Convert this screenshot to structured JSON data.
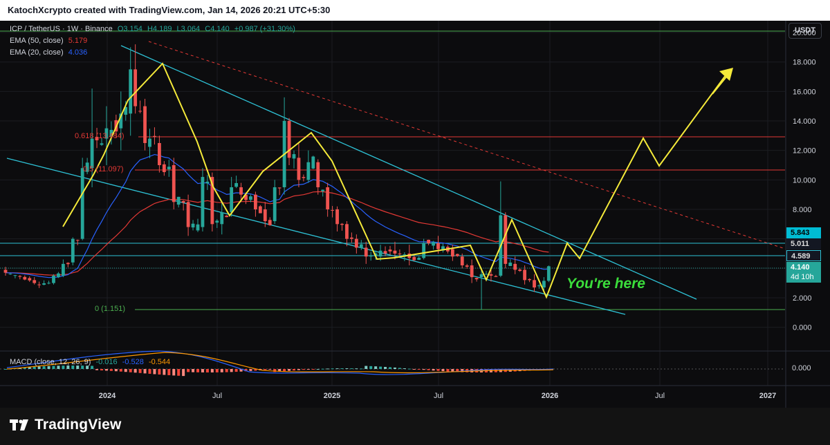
{
  "header": {
    "text": "KatochXcrypto created with TradingView.com, Jan 14, 2026 20:21 UTC+5:30"
  },
  "legend": {
    "symbol": "ICP / TetherUS · 1W · Binance",
    "open": "O3.154",
    "high": "H4.189",
    "low": "L3.064",
    "close": "C4.140",
    "change": "+0.987 (+31.30%)",
    "ema50_label": "EMA (50, close)",
    "ema50_value": "5.179",
    "ema20_label": "EMA (20, close)",
    "ema20_value": "4.036",
    "macd_label": "MACD (close, 12, 26, 9)",
    "macd_v1": "-0.016",
    "macd_v2": "-0.528",
    "macd_v3": "-0.544"
  },
  "currency": "USDT",
  "price_labels": {
    "l1": "5.843",
    "l2": "5.011",
    "l3": "4.589",
    "current": "4.140",
    "countdown": "4d 10h"
  },
  "fib": {
    "f618": "0.618 (13.484)",
    "f5": "0.5 (11.097)",
    "f0": "0 (1.151)"
  },
  "annotation": "You're here",
  "footer_logo": "TradingView",
  "colors": {
    "bull": "#26a69a",
    "bear": "#ef5350",
    "ema50": "#e53935",
    "ema20": "#2962ff",
    "trend": "#2ec2d6",
    "fib": "#e53935",
    "fib0": "#4caf50",
    "path": "#f5ea3a",
    "annotation": "#3bdd3b"
  },
  "chart_data": {
    "type": "candlestick",
    "yaxis": {
      "ticks": [
        "0.000",
        "2.000",
        "4.000",
        "6.000",
        "8.000",
        "10.000",
        "12.000",
        "14.000",
        "16.000",
        "18.000",
        "20.000"
      ],
      "range": [
        -0.3,
        20.8
      ]
    },
    "xaxis": {
      "ticks": [
        "2024",
        "Jul",
        "2025",
        "Jul",
        "2026",
        "Jul",
        "2027"
      ]
    },
    "series": [
      {
        "name": "EMA (50, close)",
        "value": 5.179
      },
      {
        "name": "EMA (20, close)",
        "value": 4.036
      }
    ],
    "key_points": [
      {
        "t": 0,
        "o": 3.9,
        "h": 4.1,
        "l": 3.5,
        "c": 3.7
      },
      {
        "t": 6,
        "o": 3.2,
        "h": 3.4,
        "l": 2.9,
        "c": 3.0
      },
      {
        "t": 10,
        "o": 3.0,
        "h": 3.6,
        "l": 2.9,
        "c": 3.5
      },
      {
        "t": 12,
        "o": 3.5,
        "h": 4.6,
        "l": 3.4,
        "c": 4.3
      },
      {
        "t": 14,
        "o": 4.4,
        "h": 6.1,
        "l": 4.2,
        "c": 6.0
      },
      {
        "t": 16,
        "o": 6.0,
        "h": 11.5,
        "l": 5.9,
        "c": 10.8
      },
      {
        "t": 18,
        "o": 10.8,
        "h": 16.2,
        "l": 9.5,
        "c": 12.8
      },
      {
        "t": 21,
        "o": 12.8,
        "h": 15.0,
        "l": 11.0,
        "c": 13.5
      },
      {
        "t": 24,
        "o": 13.5,
        "h": 16.0,
        "l": 12.0,
        "c": 14.5
      },
      {
        "t": 26,
        "o": 14.5,
        "h": 19.0,
        "l": 13.0,
        "c": 17.5
      },
      {
        "t": 27,
        "o": 17.5,
        "h": 19.2,
        "l": 14.5,
        "c": 15.0
      },
      {
        "t": 29,
        "o": 15.0,
        "h": 15.5,
        "l": 12.0,
        "c": 12.5
      },
      {
        "t": 32,
        "o": 12.5,
        "h": 13.0,
        "l": 10.5,
        "c": 11.0
      },
      {
        "t": 35,
        "o": 11.0,
        "h": 11.5,
        "l": 8.0,
        "c": 8.5
      },
      {
        "t": 38,
        "o": 8.5,
        "h": 9.0,
        "l": 6.2,
        "c": 6.8
      },
      {
        "t": 41,
        "o": 6.8,
        "h": 10.8,
        "l": 6.5,
        "c": 10.2
      },
      {
        "t": 43,
        "o": 10.2,
        "h": 10.5,
        "l": 6.5,
        "c": 7.0
      },
      {
        "t": 45,
        "o": 7.0,
        "h": 8.5,
        "l": 6.3,
        "c": 7.8
      },
      {
        "t": 47,
        "o": 7.8,
        "h": 10.2,
        "l": 7.5,
        "c": 9.5
      },
      {
        "t": 49,
        "o": 9.5,
        "h": 9.8,
        "l": 8.5,
        "c": 9.0
      },
      {
        "t": 52,
        "o": 9.0,
        "h": 9.2,
        "l": 7.5,
        "c": 8.0
      },
      {
        "t": 54,
        "o": 8.0,
        "h": 8.5,
        "l": 6.8,
        "c": 7.2
      },
      {
        "t": 56,
        "o": 7.2,
        "h": 10.0,
        "l": 7.0,
        "c": 9.5
      },
      {
        "t": 58,
        "o": 9.5,
        "h": 15.6,
        "l": 9.0,
        "c": 14.0
      },
      {
        "t": 59,
        "o": 14.0,
        "h": 14.2,
        "l": 11.0,
        "c": 11.5
      },
      {
        "t": 61,
        "o": 11.5,
        "h": 12.5,
        "l": 9.5,
        "c": 10.0
      },
      {
        "t": 63,
        "o": 10.0,
        "h": 12.0,
        "l": 9.8,
        "c": 11.2
      },
      {
        "t": 65,
        "o": 11.2,
        "h": 11.4,
        "l": 9.0,
        "c": 9.5
      },
      {
        "t": 67,
        "o": 9.5,
        "h": 9.8,
        "l": 7.5,
        "c": 8.0
      },
      {
        "t": 69,
        "o": 8.0,
        "h": 8.2,
        "l": 6.5,
        "c": 7.0
      },
      {
        "t": 71,
        "o": 7.0,
        "h": 7.2,
        "l": 5.5,
        "c": 6.0
      },
      {
        "t": 73,
        "o": 6.0,
        "h": 6.3,
        "l": 5.0,
        "c": 5.4
      },
      {
        "t": 75,
        "o": 5.4,
        "h": 5.8,
        "l": 4.3,
        "c": 4.8
      },
      {
        "t": 78,
        "o": 4.8,
        "h": 5.6,
        "l": 4.5,
        "c": 5.2
      },
      {
        "t": 81,
        "o": 5.2,
        "h": 5.8,
        "l": 4.6,
        "c": 5.0
      },
      {
        "t": 84,
        "o": 5.0,
        "h": 5.6,
        "l": 4.2,
        "c": 4.7
      },
      {
        "t": 87,
        "o": 4.7,
        "h": 6.0,
        "l": 4.6,
        "c": 5.7
      },
      {
        "t": 90,
        "o": 5.7,
        "h": 6.2,
        "l": 5.0,
        "c": 5.3
      },
      {
        "t": 93,
        "o": 5.3,
        "h": 5.6,
        "l": 4.5,
        "c": 4.8
      },
      {
        "t": 95,
        "o": 4.8,
        "h": 5.0,
        "l": 4.0,
        "c": 4.2
      },
      {
        "t": 97,
        "o": 4.2,
        "h": 4.6,
        "l": 3.0,
        "c": 3.4
      },
      {
        "t": 99,
        "o": 3.4,
        "h": 4.0,
        "l": 1.2,
        "c": 3.6
      },
      {
        "t": 101,
        "o": 3.6,
        "h": 4.0,
        "l": 3.1,
        "c": 3.5
      },
      {
        "t": 103,
        "o": 3.5,
        "h": 9.9,
        "l": 3.4,
        "c": 7.6
      },
      {
        "t": 104,
        "o": 7.6,
        "h": 7.8,
        "l": 4.0,
        "c": 4.3
      },
      {
        "t": 106,
        "o": 4.3,
        "h": 4.8,
        "l": 3.6,
        "c": 3.9
      },
      {
        "t": 108,
        "o": 3.9,
        "h": 4.2,
        "l": 2.9,
        "c": 3.2
      },
      {
        "t": 110,
        "o": 3.2,
        "h": 3.6,
        "l": 2.4,
        "c": 2.7
      },
      {
        "t": 112,
        "o": 2.7,
        "h": 3.4,
        "l": 2.5,
        "c": 3.15
      },
      {
        "t": 113,
        "o": 3.154,
        "h": 4.189,
        "l": 3.064,
        "c": 4.14
      }
    ]
  }
}
